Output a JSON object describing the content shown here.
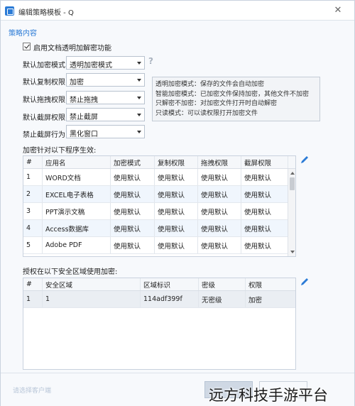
{
  "window": {
    "title": "编辑策略模板 - Q",
    "close_glyph": "✕"
  },
  "section_title": "策略内容",
  "enable_checkbox": {
    "label": "启用文档透明加解密功能",
    "checked": true
  },
  "settings": [
    {
      "label": "默认加密模式",
      "value": "透明加密模式"
    },
    {
      "label": "默认复制权限",
      "value": "加密"
    },
    {
      "label": "默认拖拽权限",
      "value": "禁止拖拽"
    },
    {
      "label": "默认截屏权限",
      "value": "禁止截屏"
    },
    {
      "label": "禁止截屏行为",
      "value": "黑化窗口"
    }
  ],
  "help_glyph": "?",
  "tooltip": {
    "lines": [
      "透明加密模式：保存的文件会自动加密",
      "智能加密模式：已加密文件保持加密，其他文件不加密",
      "只解密不加密：对加密文件打开时自动解密",
      "只读模式：可以读权限打开加密文件"
    ]
  },
  "programs": {
    "title": "加密针对以下程序生效:",
    "columns": [
      "#",
      "应用名",
      "加密模式",
      "复制权限",
      "拖拽权限",
      "截屏权限"
    ],
    "rows": [
      [
        "1",
        "WORD文档",
        "使用默认",
        "使用默认",
        "使用默认",
        "使用默认"
      ],
      [
        "2",
        "EXCEL电子表格",
        "使用默认",
        "使用默认",
        "使用默认",
        "使用默认"
      ],
      [
        "3",
        "PPT演示文稿",
        "使用默认",
        "使用默认",
        "使用默认",
        "使用默认"
      ],
      [
        "4",
        "Access数据库",
        "使用默认",
        "使用默认",
        "使用默认",
        "使用默认"
      ],
      [
        "5",
        "Adobe PDF",
        "使用默认",
        "使用默认",
        "使用默认",
        "使用默认"
      ]
    ]
  },
  "zones": {
    "title": "授权在以下安全区域使用加密:",
    "columns": [
      "#",
      "安全区域",
      "区域标识",
      "密级",
      "权限"
    ],
    "rows": [
      [
        "1",
        "1",
        "114adf399f",
        "无密级",
        "加密"
      ]
    ]
  },
  "footer": {
    "link": "请选择客户端"
  },
  "watermark": "远方科技手游平台",
  "colors": {
    "accent": "#2b7bd6",
    "row_highlight": "#f0f6fd"
  }
}
